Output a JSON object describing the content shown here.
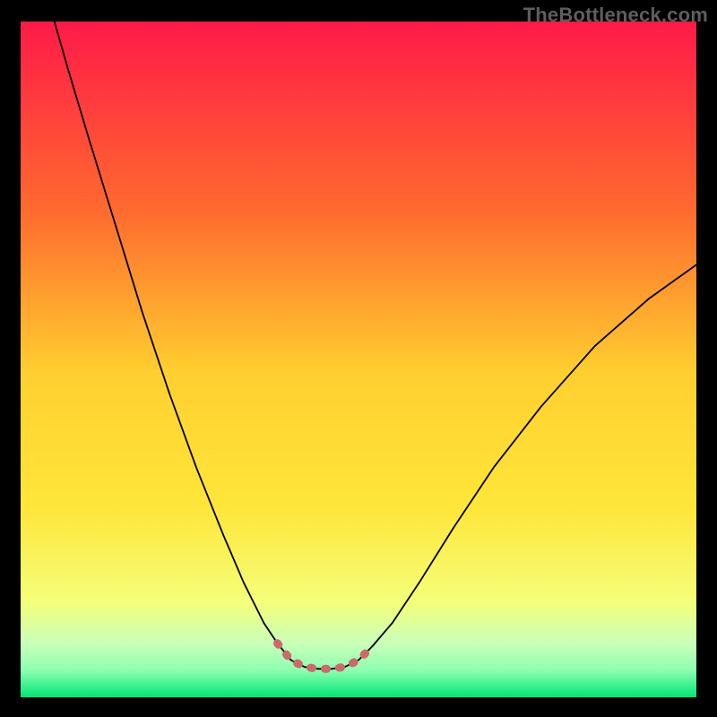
{
  "watermark": "TheBottleneck.com",
  "chart_data": {
    "type": "line",
    "title": "",
    "xlabel": "",
    "ylabel": "",
    "xlim": [
      0,
      100
    ],
    "ylim": [
      0,
      100
    ],
    "background_gradient": {
      "top": "#ff1a48",
      "mid_upper": "#ff9a2a",
      "mid": "#ffe63a",
      "mid_lower": "#f4ff7a",
      "light_green": "#c9ffb9",
      "green": "#00e676",
      "bottom": "#00c567"
    },
    "series": [
      {
        "name": "bottleneck-curve",
        "color": "#000000",
        "width": 1.8,
        "points": [
          {
            "x": 5.0,
            "y": 100.0
          },
          {
            "x": 7.0,
            "y": 93.0
          },
          {
            "x": 10.0,
            "y": 83.0
          },
          {
            "x": 14.0,
            "y": 70.0
          },
          {
            "x": 18.0,
            "y": 57.0
          },
          {
            "x": 22.0,
            "y": 45.0
          },
          {
            "x": 26.0,
            "y": 34.0
          },
          {
            "x": 30.0,
            "y": 24.0
          },
          {
            "x": 33.0,
            "y": 17.0
          },
          {
            "x": 36.0,
            "y": 11.0
          },
          {
            "x": 38.0,
            "y": 8.0
          },
          {
            "x": 40.0,
            "y": 5.5
          },
          {
            "x": 42.0,
            "y": 4.5
          },
          {
            "x": 44.0,
            "y": 4.2
          },
          {
            "x": 46.0,
            "y": 4.2
          },
          {
            "x": 48.0,
            "y": 4.5
          },
          {
            "x": 50.0,
            "y": 5.5
          },
          {
            "x": 52.0,
            "y": 7.5
          },
          {
            "x": 55.0,
            "y": 11.0
          },
          {
            "x": 59.0,
            "y": 17.0
          },
          {
            "x": 64.0,
            "y": 25.0
          },
          {
            "x": 70.0,
            "y": 34.0
          },
          {
            "x": 77.0,
            "y": 43.0
          },
          {
            "x": 85.0,
            "y": 52.0
          },
          {
            "x": 93.0,
            "y": 59.0
          },
          {
            "x": 100.0,
            "y": 64.0
          }
        ]
      },
      {
        "name": "valley-overlay",
        "color": "#cb6a6a",
        "width": 9,
        "dotted": true,
        "points": [
          {
            "x": 38.0,
            "y": 8.0
          },
          {
            "x": 40.0,
            "y": 5.5
          },
          {
            "x": 42.0,
            "y": 4.5
          },
          {
            "x": 44.0,
            "y": 4.2
          },
          {
            "x": 46.0,
            "y": 4.2
          },
          {
            "x": 48.0,
            "y": 4.5
          },
          {
            "x": 50.0,
            "y": 5.5
          },
          {
            "x": 52.0,
            "y": 7.5
          }
        ]
      }
    ]
  }
}
